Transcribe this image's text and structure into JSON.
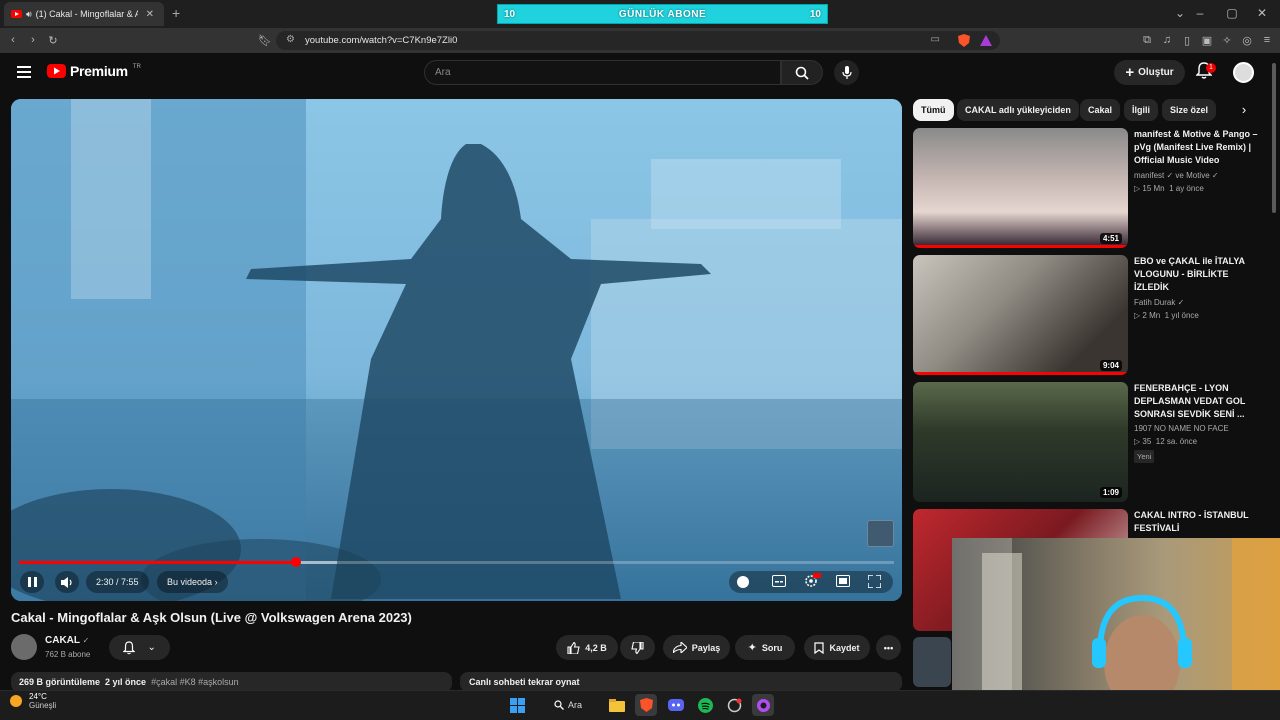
{
  "browser": {
    "tab_title": "(1) Cakal - Mingoflalar & Aşk",
    "url": "youtube.com/watch?v=C7Kn9e7Zli0"
  },
  "overlay": {
    "left_count": "10",
    "label": "GÜNLÜK ABONE",
    "right_count": "10"
  },
  "header": {
    "logo": "Premium",
    "logo_sup": "TR",
    "search_placeholder": "Ara",
    "create_label": "Oluştur",
    "notif_count": "1"
  },
  "player": {
    "time": "2:30 / 7:55",
    "chapter": "Bu videoda",
    "progress_fraction": 0.316,
    "buffer_fraction": 0.363
  },
  "video": {
    "title": "Cakal - Mingoflalar & Aşk Olsun (Live @ Volkswagen Arena 2023)",
    "channel": "CAKAL",
    "subs": "762 B abone",
    "likes": "4,2 B",
    "share": "Paylaş",
    "ask": "Soru",
    "save": "Kaydet",
    "desc_views": "269 B görüntüleme",
    "desc_age": "2 yıl önce",
    "desc_tags": "#çakal #K8 #aşkolsun",
    "livechat": "Canlı sohbeti tekrar oynat"
  },
  "chips": [
    "Tümü",
    "CAKAL adlı yükleyiciden",
    "Cakal",
    "İlgili",
    "Size özel"
  ],
  "recommendations": [
    {
      "title": "manifest & Motive & Pango – pVg (Manifest Live Remix) | Official Music Video",
      "channel": "manifest",
      "channel2": "ve Motive",
      "views": "15 Mn",
      "age": "1 ay önce",
      "duration": "4:51"
    },
    {
      "title": "EBO ve ÇAKAL ile İTALYA VLOGUNU - BİRLİKTE İZLEDİK",
      "channel": "Fatih Durak",
      "views": "2 Mn",
      "age": "1 yıl önce",
      "duration": "9:04"
    },
    {
      "title": "FENERBAHÇE - LYON DEPLASMAN VEDAT GOL SONRASI SEVDİK SENİ ...",
      "channel": "1907 NO NAME NO FACE",
      "views": "35",
      "age": "12 sa. önce",
      "duration": "1:09",
      "badge": "Yeni"
    },
    {
      "title": "CAKAL INTRO - İSTANBUL FESTİVALİ",
      "channel": "",
      "views": "",
      "age": "",
      "duration": ""
    }
  ],
  "taskbar": {
    "temp": "24°C",
    "cond": "Güneşli",
    "search": "Ara"
  },
  "colors": {
    "accent": "#ff0000",
    "overlay": "#1fd2dd"
  }
}
